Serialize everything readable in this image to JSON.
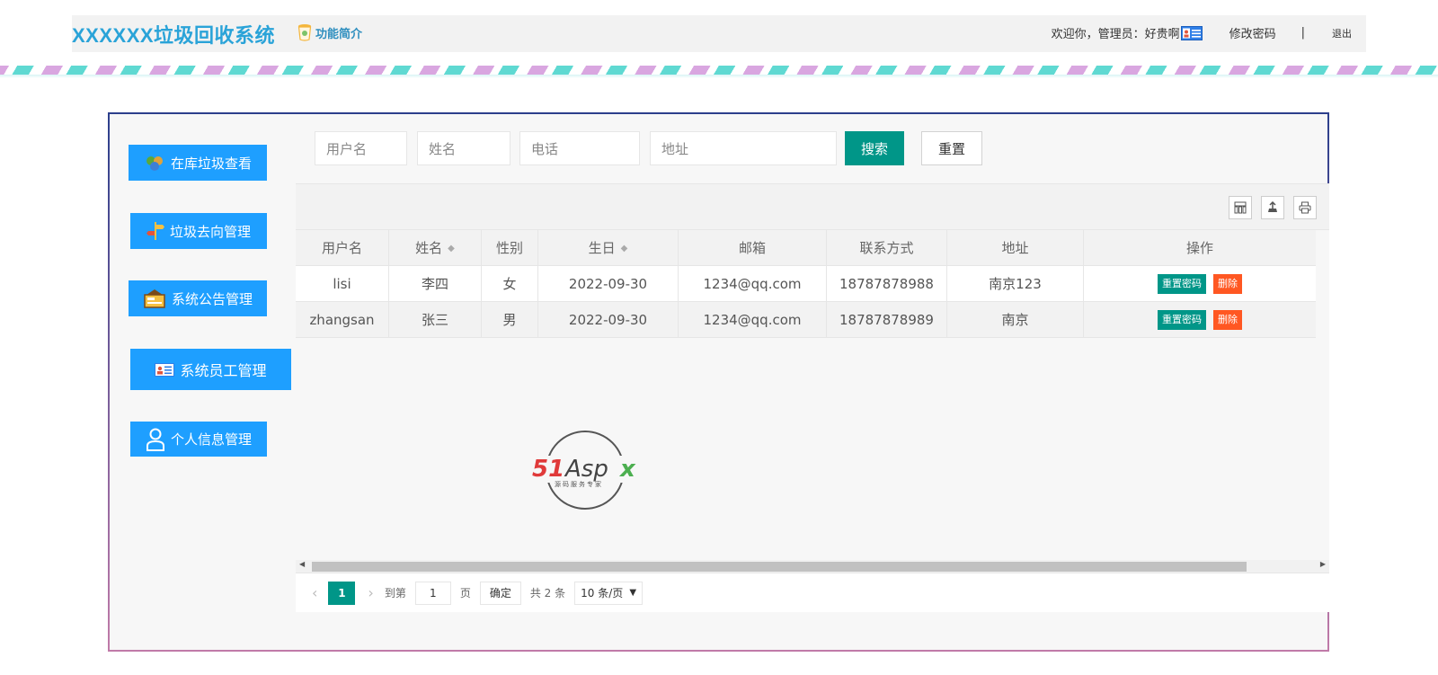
{
  "header": {
    "app_title": "XXXXXX垃圾回收系统",
    "intro_link": "功能简介",
    "welcome": "欢迎你，管理员：好贵啊",
    "change_password": "修改密码",
    "separator": "|",
    "logout": "退出"
  },
  "sidebar": {
    "items": [
      {
        "label": "在库垃圾查看",
        "icon": "recycle-icon"
      },
      {
        "label": "垃圾去向管理",
        "icon": "signpost-icon"
      },
      {
        "label": "系统公告管理",
        "icon": "notice-board-icon"
      },
      {
        "label": "系统员工管理",
        "icon": "id-card-icon"
      },
      {
        "label": "个人信息管理",
        "icon": "person-icon"
      }
    ]
  },
  "search": {
    "username_placeholder": "用户名",
    "name_placeholder": "姓名",
    "phone_placeholder": "电话",
    "address_placeholder": "地址",
    "search_label": "搜索",
    "reset_label": "重置"
  },
  "table": {
    "columns": [
      "用户名",
      "姓名",
      "性别",
      "生日",
      "邮箱",
      "联系方式",
      "地址",
      "操作"
    ],
    "sortable": [
      "姓名",
      "生日"
    ],
    "rows": [
      {
        "username": "lisi",
        "name": "李四",
        "gender": "女",
        "birthday": "2022-09-30",
        "email": "1234@qq.com",
        "phone": "18787878988",
        "address": "南京123"
      },
      {
        "username": "zhangsan",
        "name": "张三",
        "gender": "男",
        "birthday": "2022-09-30",
        "email": "1234@qq.com",
        "phone": "18787878989",
        "address": "南京"
      }
    ],
    "row_actions": {
      "reset_password": "重置密码",
      "delete": "删除"
    }
  },
  "pager": {
    "current_page": "1",
    "goto_prefix": "到第",
    "goto_value": "1",
    "goto_suffix": "页",
    "confirm": "确定",
    "total": "共 2 条",
    "page_size": "10 条/页"
  },
  "watermark": {
    "brand": "51Aspx",
    "tagline": "源码服务专家"
  },
  "colors": {
    "primary_blue": "#1e9fff",
    "teal": "#009688",
    "danger": "#ff5722",
    "title_blue": "#2aa3d8"
  }
}
